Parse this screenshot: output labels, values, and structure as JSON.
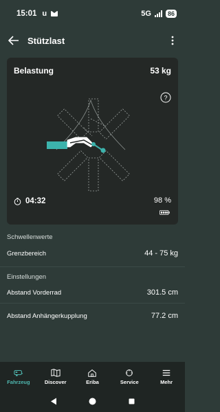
{
  "status_bar": {
    "time": "15:01",
    "carrier_letter": "u",
    "network": "5G",
    "battery": "86"
  },
  "app_bar": {
    "title": "Stützlast"
  },
  "card": {
    "label": "Belastung",
    "value": "53 kg",
    "timer": "04:32",
    "battery_percent": "98 %",
    "accent_color": "#3cb3ac"
  },
  "thresholds": {
    "section_title": "Schwellenwerte",
    "limit_label": "Grenzbereich",
    "limit_value": "44 - 75 kg"
  },
  "settings": {
    "section_title": "Einstellungen",
    "front_wheel_label": "Abstand Vorderrad",
    "front_wheel_value": "301.5 cm",
    "hitch_label": "Abstand Anhängerkupplung",
    "hitch_value": "77.2 cm"
  },
  "bottom_nav": {
    "items": [
      {
        "label": "Fahrzeug",
        "icon": "caravan-icon",
        "active": true
      },
      {
        "label": "Discover",
        "icon": "map-icon",
        "active": false
      },
      {
        "label": "Eriba",
        "icon": "home-icon",
        "active": false
      },
      {
        "label": "Service",
        "icon": "service-icon",
        "active": false
      },
      {
        "label": "Mehr",
        "icon": "menu-icon",
        "active": false
      }
    ]
  },
  "colors": {
    "background": "#2e3b38",
    "card": "#242826",
    "accent": "#4fb8b0",
    "nav": "#1f2523"
  }
}
